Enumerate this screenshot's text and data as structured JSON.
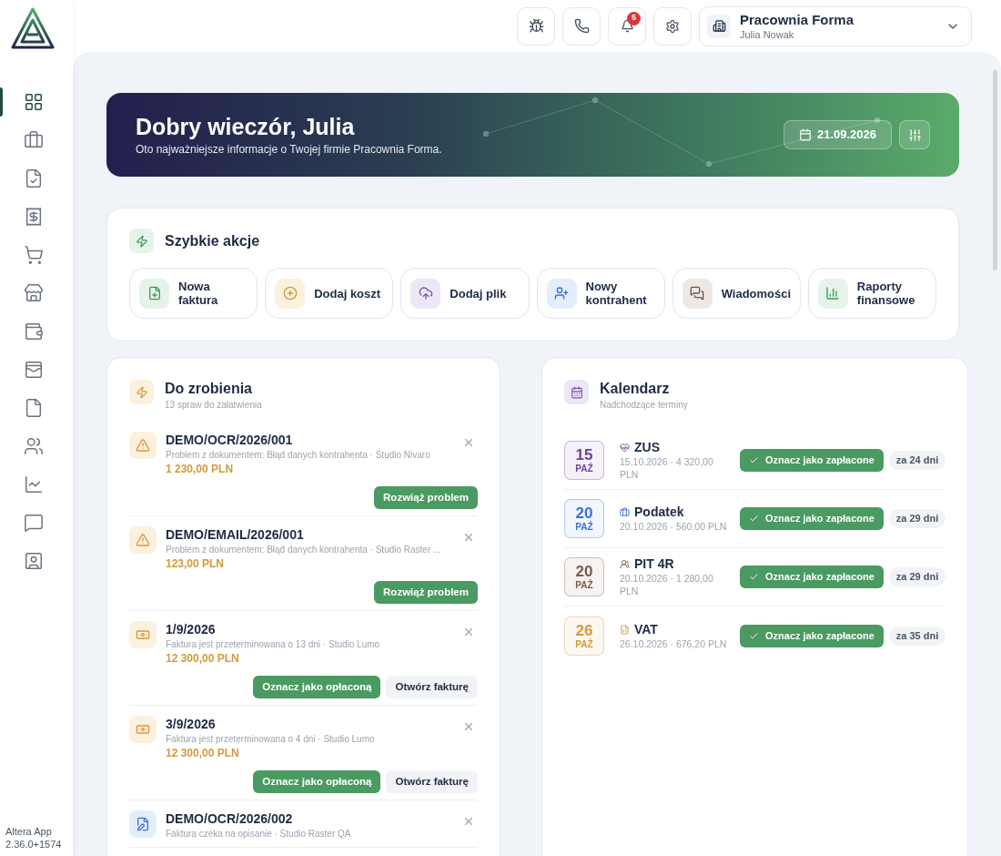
{
  "sidebar": {
    "items": [
      {
        "selected": true
      },
      {
        "selected": false
      },
      {
        "selected": false
      },
      {
        "selected": false
      },
      {
        "selected": false
      },
      {
        "selected": false
      },
      {
        "selected": false
      },
      {
        "selected": false
      },
      {
        "selected": false
      },
      {
        "selected": false
      },
      {
        "selected": false
      },
      {
        "selected": false
      },
      {
        "selected": false
      }
    ],
    "footer": [
      "Altera App",
      "2.36.0+1574"
    ]
  },
  "topbar": {
    "notifications": "5",
    "company": "Pracownia Forma",
    "user": "Julia Nowak"
  },
  "banner": {
    "title": "Dobry wieczór, Julia",
    "subtitle": "Oto najważniejsze informacje o Twojej firmie Pracownia Forma.",
    "date": "21.09.2026"
  },
  "quick_actions": {
    "title": "Szybkie akcje",
    "items": [
      {
        "kind": "invoice",
        "label": "Nowa\nfaktura"
      },
      {
        "kind": "cost",
        "label": "Dodaj koszt"
      },
      {
        "kind": "upload",
        "label": "Dodaj plik"
      },
      {
        "kind": "contact",
        "label": "Nowy\nkontrahent"
      },
      {
        "kind": "messages",
        "label": "Wiadomości"
      },
      {
        "kind": "reports",
        "label": "Raporty\nfinansowe"
      }
    ]
  },
  "todo": {
    "title": "Do zrobienia",
    "subtitle": "13 spraw do załatwienia",
    "items": [
      {
        "kind": "warning",
        "title": "DEMO/OCR/2026/001",
        "description": "Problem z dokumentem: Błąd danych kontrahenta · Studio Nivaro",
        "amount": "1 230,00 PLN",
        "actions": [
          {
            "kind": "primary",
            "label": "Rozwiąż problem"
          }
        ]
      },
      {
        "kind": "warning",
        "title": "DEMO/EMAIL/2026/001",
        "description": "Problem z dokumentem: Błąd danych kontrahenta · Studio Raster ...",
        "amount": "123,00 PLN",
        "actions": [
          {
            "kind": "primary",
            "label": "Rozwiąż problem"
          }
        ]
      },
      {
        "kind": "overdue",
        "title": "1/9/2026",
        "description": "Faktura jest przeterminowana o 13 dni · Studio Lumo",
        "amount": "12 300,00 PLN",
        "actions": [
          {
            "kind": "primary",
            "label": "Oznacz jako opłaconą"
          },
          {
            "kind": "secondary",
            "label": "Otwórz fakturę"
          }
        ]
      },
      {
        "kind": "overdue",
        "title": "3/9/2026",
        "description": "Faktura jest przeterminowana o 4 dni · Studio Lumo",
        "amount": "12 300,00 PLN",
        "actions": [
          {
            "kind": "primary",
            "label": "Oznacz jako opłaconą"
          },
          {
            "kind": "secondary",
            "label": "Otwórz fakturę"
          }
        ]
      },
      {
        "kind": "document",
        "title": "DEMO/OCR/2026/002",
        "description": "Faktura czeka na opisanie · Studio Raster QA"
      }
    ]
  },
  "calendar": {
    "title": "Kalendarz",
    "subtitle": "Nadchodzące terminy",
    "events": [
      {
        "day": "15",
        "month": "PAŹ",
        "color": "#6b3fa0",
        "kind": "health",
        "title": "ZUS",
        "details": "15.10.2026 · 4 320,00 PLN",
        "action": "Oznacz jako zapłacone",
        "due": "za 24 dni"
      },
      {
        "day": "20",
        "month": "PAŹ",
        "color": "#3b6fd8",
        "kind": "tax",
        "title": "Podatek",
        "details": "20.10.2026 · 560,00 PLN",
        "action": "Oznacz jako zapłacone",
        "due": "za 29 dni"
      },
      {
        "day": "20",
        "month": "PAŹ",
        "color": "#7a5a48",
        "kind": "people",
        "title": "PIT 4R",
        "details": "20.10.2026 · 1 280,00 PLN",
        "action": "Oznacz jako zapłacone",
        "due": "za 29 dni"
      },
      {
        "day": "26",
        "month": "PAŹ",
        "color": "#d39a3a",
        "kind": "vat",
        "title": "VAT",
        "details": "26.10.2026 · 676,20 PLN",
        "action": "Oznacz jako zapłacone",
        "due": "za 35 dni"
      }
    ]
  }
}
